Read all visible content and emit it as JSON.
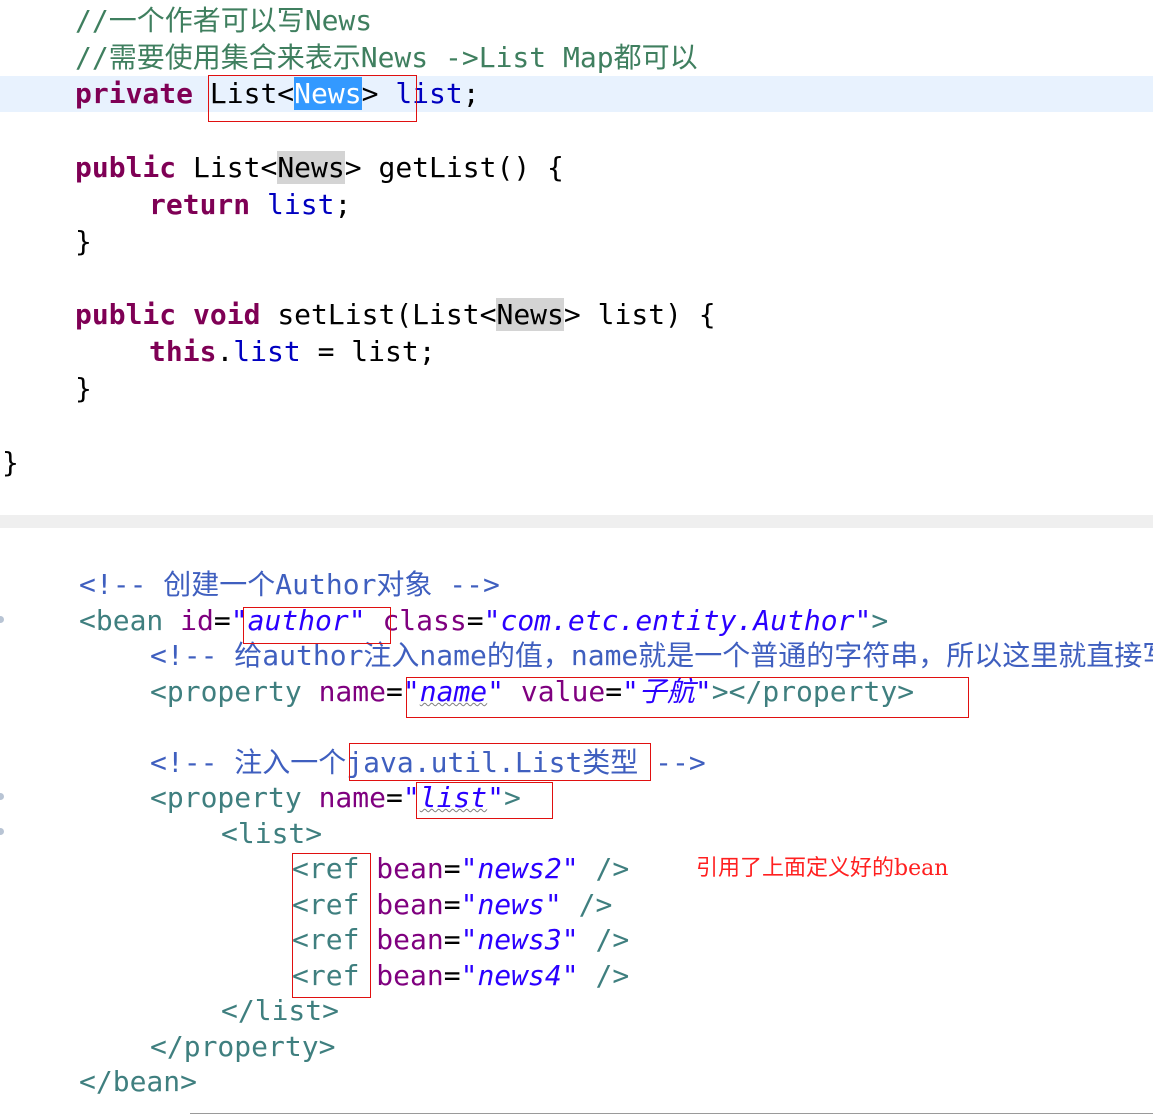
{
  "java_editor": {
    "comment1": "//一个作者可以写News",
    "comment2": "//需要使用集合来表示News ->List Map都可以",
    "field_decl": {
      "modifier": "private",
      "type_open": "List<",
      "type_arg": "News",
      "type_close": ">",
      "name": "list",
      "semicolon": ";"
    },
    "getter": {
      "modifier": "public",
      "type_open": "List<",
      "type_arg": "News",
      "signature": "> getList() {",
      "return_kw": "return",
      "return_var": "list",
      "semicolon": ";",
      "close": "}"
    },
    "setter": {
      "modifier": "public",
      "void_kw": "void",
      "sig_open": "setList(List<",
      "type_arg": "News",
      "sig_close": "> list) {",
      "this_kw": "this",
      "dot": ".",
      "field": "list",
      "assign": " = list;",
      "close": "}"
    },
    "class_close": "}"
  },
  "xml_editor": {
    "comment_create": "<!-- 创建一个Author对象 -->",
    "bean_open": {
      "lt": "<",
      "tag": "bean",
      "id_attr": "id",
      "eq": "=",
      "id_value": "\"author\"",
      "class_attr": "class",
      "class_value": "\"com.etc.entity.Author\"",
      "gt": ">"
    },
    "comment_name": "<!-- 给author注入name的值，name就是一个普通的字符串，所以这里就直接写 -->",
    "property_name": {
      "open_tag": "<property",
      "name_attr": "name",
      "eq": "=",
      "quote": "\"",
      "name_value": "name",
      "value_attr": "value",
      "value_value": "\"子航\"",
      "close_tag": "></property>"
    },
    "comment_list_prefix": "<!-- 注入一个j",
    "comment_list_middle": "ava.util.List类型 -",
    "comment_list_suffix": "->",
    "property_list": {
      "open_tag": "<property",
      "name_attr": "name",
      "eq": "=",
      "quote": "\"",
      "name_value": "list",
      "gt": ">"
    },
    "list_open": "<list>",
    "refs": [
      {
        "lt": "<",
        "tag": "ref",
        "attr": "bean",
        "eq": "=",
        "value": "\"news2\"",
        "end": "/>"
      },
      {
        "lt": "<",
        "tag": "ref",
        "attr": "bean",
        "eq": "=",
        "value": "\"news\"",
        "end": "/>"
      },
      {
        "lt": "<",
        "tag": "ref",
        "attr": "bean",
        "eq": "=",
        "value": "\"news3\"",
        "end": "/>"
      },
      {
        "lt": "<",
        "tag": "ref",
        "attr": "bean",
        "eq": "=",
        "value": "\"news4\"",
        "end": "/>"
      }
    ],
    "list_close": "</list>",
    "property_close": "</property>",
    "bean_close": "</bean>",
    "annotation": "引用了上面定义好的bean"
  }
}
